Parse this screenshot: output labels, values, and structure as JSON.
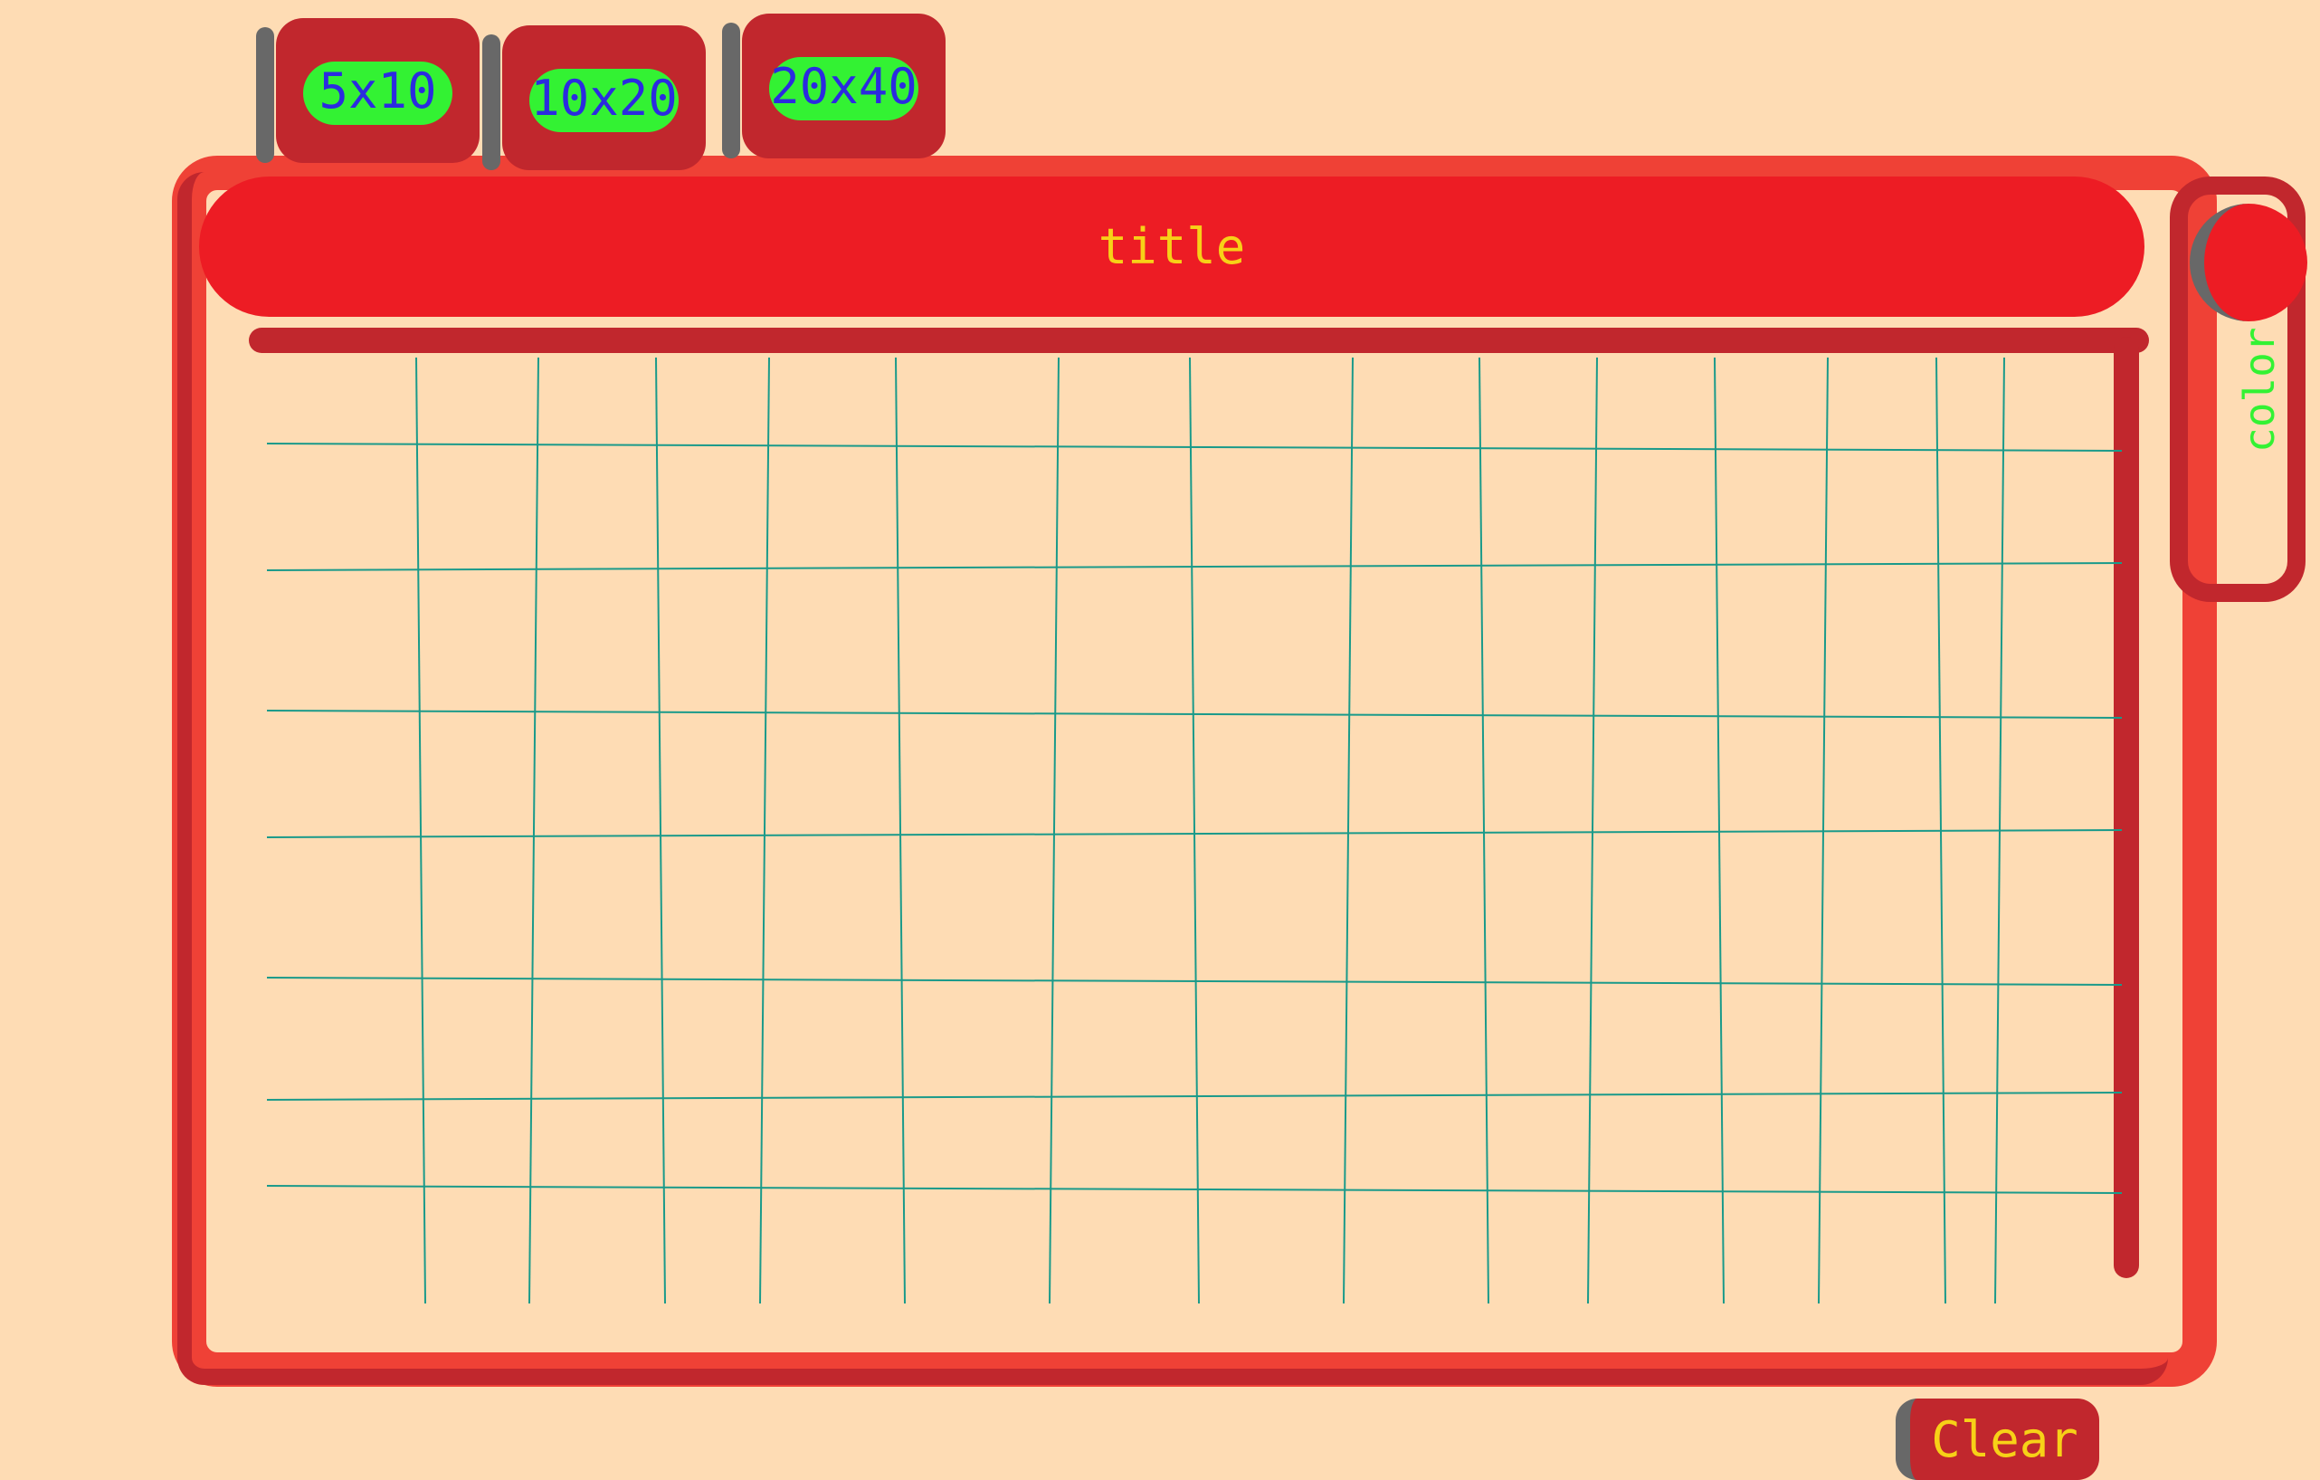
{
  "toolbar": {
    "size_buttons": [
      {
        "label": "5x10"
      },
      {
        "label": "10x20"
      },
      {
        "label": "20x40"
      }
    ]
  },
  "header": {
    "title": "title"
  },
  "color_picker": {
    "label": "color",
    "selected_color": "#ed1c24"
  },
  "actions": {
    "clear_label": "Clear"
  },
  "colors": {
    "background": "#fedcb4",
    "frame": "#ef4136",
    "frame_dark": "#c1272d",
    "title_bar": "#ed1c24",
    "title_text": "#f7d117",
    "button_label": "#2b2be0",
    "highlight": "#33f233",
    "grid_lines": "#1a9a8a"
  }
}
